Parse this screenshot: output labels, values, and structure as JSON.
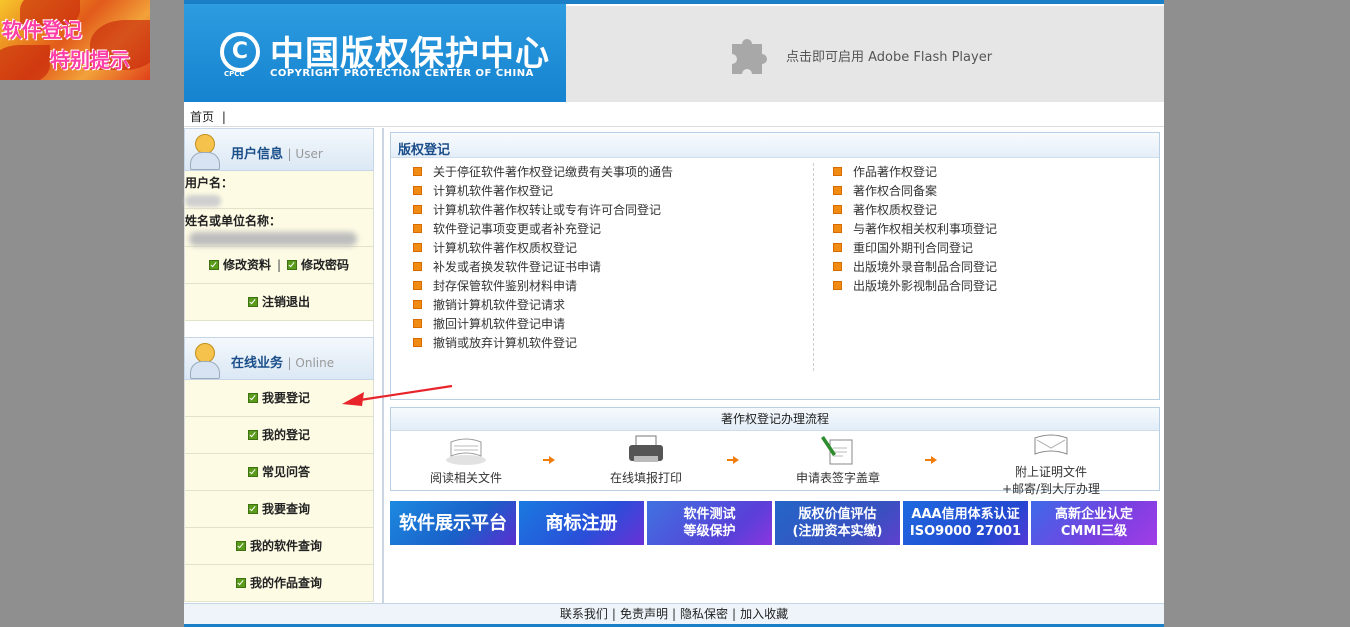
{
  "side_ad": {
    "line1": "软件登记",
    "line2": "特别提示"
  },
  "banner": {
    "logo_mark": "C",
    "logo_abbr": "CPCC",
    "logo_cn": "中国版权保护中心",
    "logo_en": "COPYRIGHT PROTECTION CENTER OF CHINA",
    "flash_text": "点击即可启用 Adobe Flash Player"
  },
  "nav": {
    "home": "首页",
    "sep": "|"
  },
  "user_panel": {
    "title": "用户信息",
    "subtitle": "| User",
    "username_label": "用户名：",
    "org_label": "姓名或单位名称：",
    "edit_profile": "修改资料",
    "sep": "|",
    "change_password": "修改密码",
    "logout": "注销退出"
  },
  "online_panel": {
    "title": "在线业务",
    "subtitle": "| Online",
    "items": [
      "我要登记",
      "我的登记",
      "常见问答",
      "我要查询",
      "我的软件查询",
      "我的作品查询"
    ]
  },
  "registration": {
    "title": "版权登记",
    "left_items": [
      "关于停征软件著作权登记缴费有关事项的通告",
      "计算机软件著作权登记",
      "计算机软件著作权转让或专有许可合同登记",
      "软件登记事项变更或者补充登记",
      "计算机软件著作权质权登记",
      "补发或者换发软件登记证书申请",
      "封存保管软件鉴别材料申请",
      "撤销计算机软件登记请求",
      "撤回计算机软件登记申请",
      "撤销或放弃计算机软件登记"
    ],
    "right_items": [
      "作品著作权登记",
      "著作权合同备案",
      "著作权质权登记",
      "与著作权相关权利事项登记",
      "重印国外期刊合同登记",
      "出版境外录音制品合同登记",
      "出版境外影视制品合同登记"
    ]
  },
  "process": {
    "title": "著作权登记办理流程",
    "steps": [
      {
        "label": "阅读相关文件",
        "icon": "document-stack-icon"
      },
      {
        "label": "在线填报打印",
        "icon": "printer-icon"
      },
      {
        "label": "申请表签字盖章",
        "icon": "pen-sign-icon"
      },
      {
        "label1": "附上证明文件",
        "label2": "+邮寄/到大厅办理",
        "icon": "envelope-icon"
      }
    ]
  },
  "ads": [
    {
      "text": "软件展示平台",
      "color": "#1f6fd0"
    },
    {
      "text": "商标注册",
      "color": "#1f5fd8"
    },
    {
      "line1": "软件测试",
      "line2": "等级保护",
      "color": "#4c53d6"
    },
    {
      "line1": "版权价值评估",
      "line2": "(注册资本实缴)",
      "color": "#3a58c4"
    },
    {
      "line1": "AAA信用体系认证",
      "line2": "ISO9000 27001",
      "color": "#2350d8"
    },
    {
      "line1": "高新企业认定",
      "line2": "CMMI三级",
      "color": "#7a3fe0"
    }
  ],
  "footer": {
    "links": [
      "联系我们",
      "免责声明",
      "隐私保密",
      "加入收藏"
    ],
    "sep": "|"
  }
}
